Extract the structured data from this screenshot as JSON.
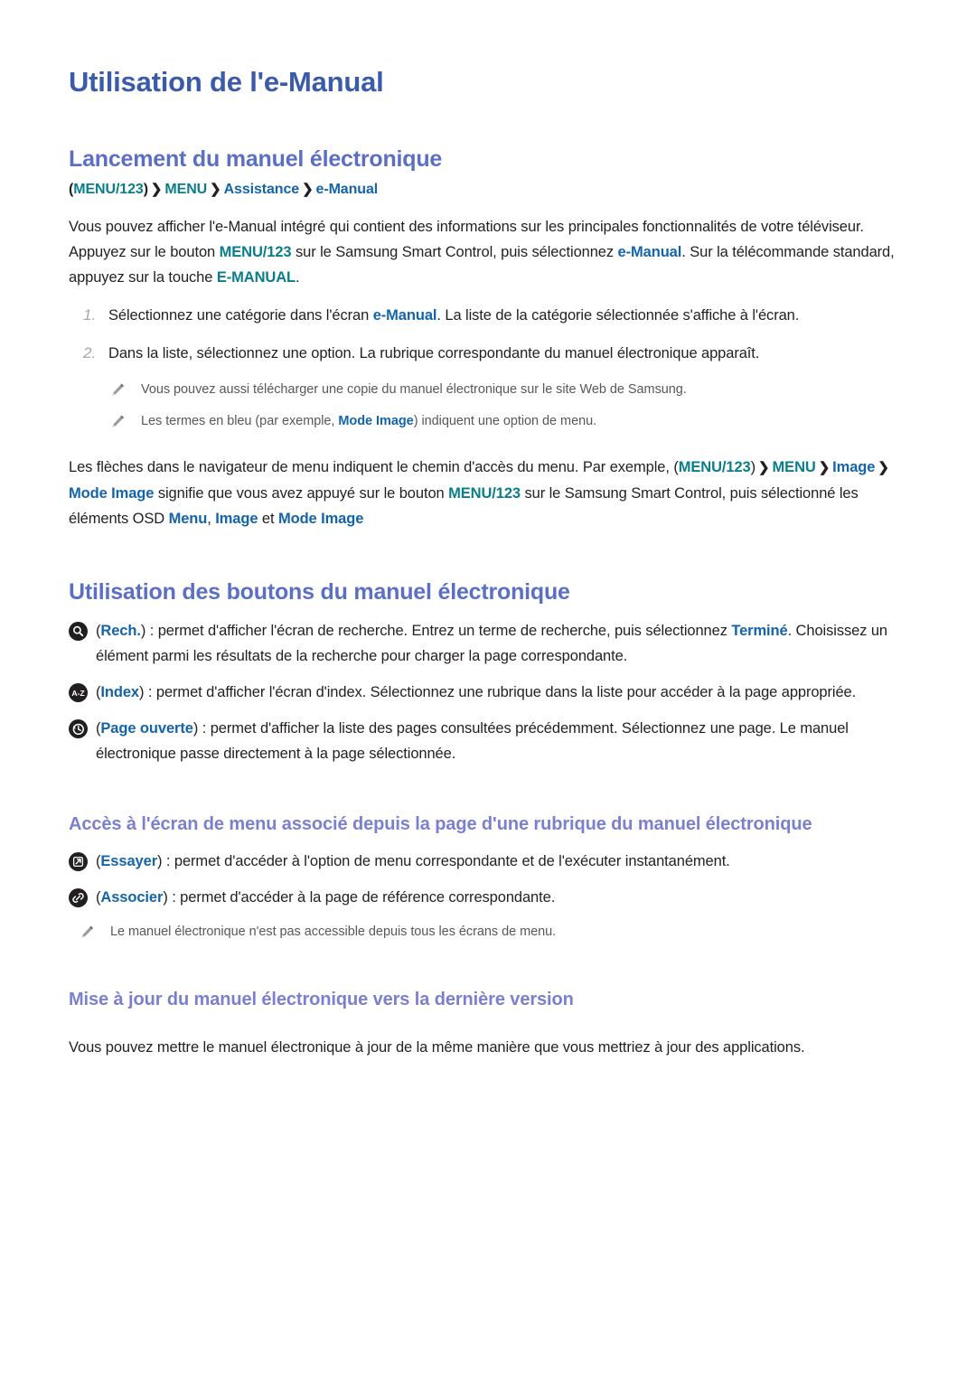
{
  "document": {
    "title": "Utilisation de l'e-Manual"
  },
  "colors": {
    "h1": "#3a5ba9",
    "h2": "#5b6fc4",
    "h3": "#7b7fd0",
    "teal_token": "#0a7d8c",
    "blue_token": "#1464aa",
    "body_text": "#231f20",
    "note_text": "#58585a",
    "step_number": "#a8a8a8",
    "icon_circle": "#231f20"
  },
  "section1": {
    "heading": "Lancement du manuel électronique",
    "breadcrumb": {
      "open_paren": "(",
      "item1": "MENU/123",
      "close_paren": ")",
      "sep": "❯",
      "item2": "MENU",
      "item3": "Assistance",
      "item4": "e-Manual"
    },
    "intro": {
      "p1": "Vous pouvez afficher l'e-Manual intégré qui contient des informations sur les principales fonctionnalités de votre téléviseur. Appuyez sur le bouton ",
      "token_menu123": "MENU/123",
      "p2": " sur le Samsung Smart Control, puis sélectionnez ",
      "token_emanual": "e-Manual",
      "p3": ". Sur la télécommande standard, appuyez sur la touche ",
      "token_emanual_key": "E-MANUAL",
      "p4": "."
    },
    "steps": [
      {
        "number": "1.",
        "pre": "Sélectionnez une catégorie dans l'écran ",
        "token": "e-Manual",
        "post": ". La liste de la catégorie sélectionnée s'affiche à l'écran."
      },
      {
        "number": "2.",
        "pre": "Dans la liste, sélectionnez une option. La rubrique correspondante du manuel électronique apparaît.",
        "token": "",
        "post": ""
      }
    ],
    "notes": [
      {
        "icon": "pencil-icon",
        "pre": "Vous pouvez aussi télécharger une copie du manuel électronique sur le site Web de Samsung.",
        "token": "",
        "post": ""
      },
      {
        "icon": "pencil-icon",
        "pre": "Les termes en bleu (par exemple, ",
        "token": "Mode Image",
        "post": ") indiquent une option de menu."
      }
    ],
    "navigation_paragraph": {
      "p1": "Les flèches dans le navigateur de menu indiquent le chemin d'accès du menu. Par exemple, (",
      "token_menu123": "MENU/123",
      "p2": ")",
      "sep": "❯",
      "token_menu": "MENU",
      "token_image": "Image",
      "token_mode_image": "Mode Image",
      "p3": " signifie que vous avez appuyé sur le bouton ",
      "token_menu123_b": "MENU/123",
      "p4": " sur le Samsung Smart Control, puis sélectionné les éléments OSD ",
      "token_osd_menu": "Menu",
      "comma": ", ",
      "token_osd_image": "Image",
      "p5": " et ",
      "token_osd_mode_image": "Mode Image"
    }
  },
  "section2": {
    "heading": "Utilisation des boutons du manuel électronique",
    "buttons": [
      {
        "icon": "search-icon",
        "open_paren": "(",
        "label": "Rech.",
        "close_paren": ")",
        "pre": " : permet d'afficher l'écran de recherche. Entrez un terme de recherche, puis sélectionnez ",
        "token": "Terminé",
        "post": ". Choisissez un élément parmi les résultats de la recherche pour charger la page correspondante."
      },
      {
        "icon": "az-index-icon",
        "open_paren": "(",
        "label": "Index",
        "close_paren": ")",
        "pre": " : permet d'afficher l'écran d'index. Sélectionnez une rubrique dans la liste pour accéder à la page appropriée.",
        "token": "",
        "post": ""
      },
      {
        "icon": "history-clock-icon",
        "open_paren": "(",
        "label": "Page ouverte",
        "close_paren": ")",
        "pre": " : permet d'afficher la liste des pages consultées précédemment. Sélectionnez une page. Le manuel électronique passe directement à la page sélectionnée.",
        "token": "",
        "post": ""
      }
    ]
  },
  "section3": {
    "heading": "Accès à l'écran de menu associé depuis la page d'une rubrique du manuel électronique",
    "buttons": [
      {
        "icon": "external-link-icon",
        "open_paren": "(",
        "label": "Essayer",
        "close_paren": ")",
        "pre": " : permet d'accéder à l'option de menu correspondante et de l'exécuter instantanément.",
        "token": "",
        "post": ""
      },
      {
        "icon": "chain-link-icon",
        "open_paren": "(",
        "label": "Associer",
        "close_paren": ")",
        "pre": " : permet d'accéder à la page de référence correspondante.",
        "token": "",
        "post": ""
      }
    ],
    "note": {
      "icon": "pencil-icon",
      "text": "Le manuel électronique n'est pas accessible depuis tous les écrans de menu."
    }
  },
  "section4": {
    "heading": "Mise à jour du manuel électronique vers la dernière version",
    "paragraph": "Vous pouvez mettre le manuel électronique à jour de la même manière que vous mettriez à jour des applications."
  }
}
